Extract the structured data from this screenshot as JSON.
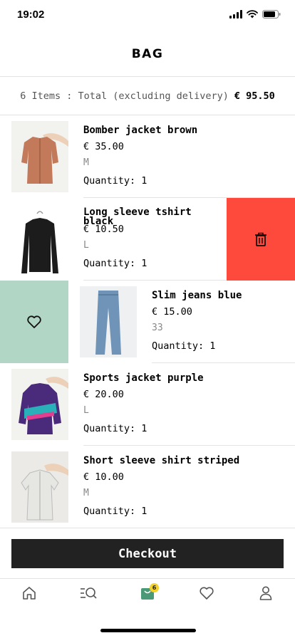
{
  "status_bar": {
    "time": "19:02"
  },
  "header": {
    "title": "BAG"
  },
  "summary": {
    "items_label": "6 Items : Total (excluding delivery)",
    "total": "€ 95.50"
  },
  "items": [
    {
      "name": "Bomber jacket brown",
      "price": "€ 35.00",
      "size": "M",
      "quantity": "Quantity: 1",
      "garment_color": "#c27a5a"
    },
    {
      "name": "Long sleeve tshirt black",
      "price": "€ 10.50",
      "size": "L",
      "quantity": "Quantity: 1",
      "garment_color": "#1c1c1c"
    },
    {
      "name": "Slim jeans blue",
      "price": "€ 15.00",
      "size": "33",
      "quantity": "Quantity: 1",
      "garment_color": "#6f94b8"
    },
    {
      "name": "Sports jacket purple",
      "price": "€ 20.00",
      "size": "L",
      "quantity": "Quantity: 1",
      "garment_color": "#4a2a7a"
    },
    {
      "name": "Short sleeve shirt striped",
      "price": "€ 10.00",
      "size": "M",
      "quantity": "Quantity: 1",
      "garment_color": "#e6e6e3"
    }
  ],
  "swipe_actions": {
    "delete_icon": "trash-icon",
    "favorite_icon": "heart-icon"
  },
  "checkout": {
    "label": "Checkout"
  },
  "tab_bar": {
    "tabs": [
      "home-icon",
      "search-list-icon",
      "bag-icon",
      "heart-icon",
      "profile-icon"
    ],
    "bag_badge": "6"
  },
  "colors": {
    "delete": "#fd4a3c",
    "favorite": "#b1d6c5",
    "accent": "#4a9a78",
    "badge": "#f5d22a",
    "checkout": "#222222"
  }
}
